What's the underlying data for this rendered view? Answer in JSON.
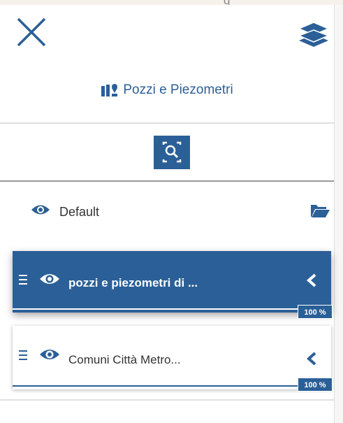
{
  "top_strip": {
    "partial_text": "g"
  },
  "header": {
    "close_icon": "close-icon",
    "layers_icon": "layers-icon"
  },
  "group": {
    "title": "Pozzi e Piezometri",
    "icon": "map-marker-icon"
  },
  "toolbar": {
    "zoom_icon": "zoom-to-extent-icon"
  },
  "default_group": {
    "label": "Default",
    "eye_icon": "eye-icon",
    "folder_icon": "folder-open-icon"
  },
  "layers": [
    {
      "name": "pozzi e piezometri di ...",
      "opacity_label": "100 %",
      "opacity": 1.0,
      "selected": true
    },
    {
      "name": "Comuni Città Metro...",
      "opacity_label": "100 %",
      "opacity": 1.0,
      "selected": false
    }
  ],
  "colors": {
    "accent": "#2b5f97",
    "text": "#333333",
    "background": "#ffffff"
  }
}
